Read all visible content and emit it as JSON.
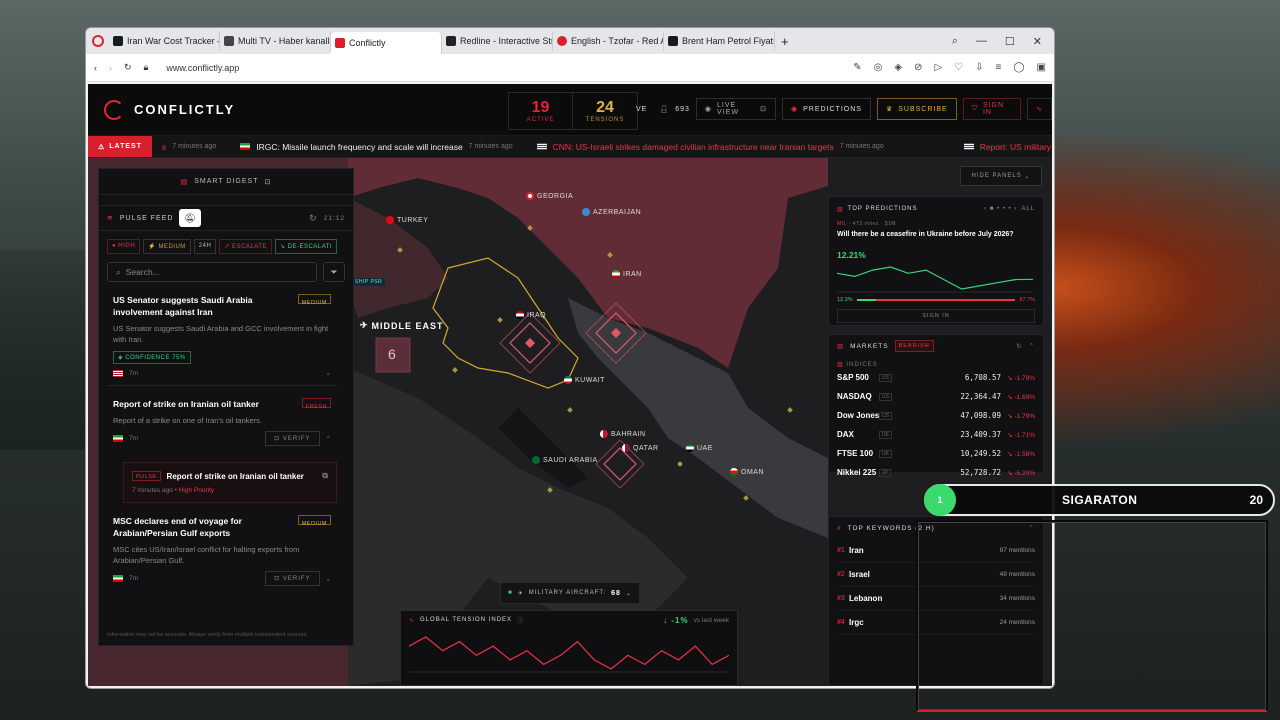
{
  "browser": {
    "tabs": [
      {
        "label": "Iran War Cost Tracker — L",
        "color": "#1a1a1a"
      },
      {
        "label": "Multi TV - Haber kanalları",
        "color": "#444444"
      },
      {
        "label": "Conflictly",
        "color": "#d91f2c"
      },
      {
        "label": "Redline - Interactive Strat",
        "color": "#222222"
      },
      {
        "label": "English - Tzofar - Red Aler",
        "color": "#d91f2c"
      },
      {
        "label": "Brent Ham Petrol Fiyatı —",
        "color": "#1a1a1a"
      }
    ],
    "url": "www.conflictly.app"
  },
  "app": {
    "name": "CONFLICTLY",
    "active": {
      "value": "19",
      "label": "ACTIVE"
    },
    "tensions": {
      "value": "24",
      "label": "TENSIONS"
    },
    "live_short": "VE",
    "viewers": "693",
    "live_view": "LIVE VIEW",
    "predictions": "PREDICTIONS",
    "subscribe": "SUBSCRIBE",
    "sign_in": "SIGN IN"
  },
  "ticker": {
    "label": "LATEST",
    "items": [
      {
        "flag": "none",
        "text": "s",
        "ago": "7 minutes ago",
        "color": "#e34"
      },
      {
        "flag": "ir",
        "text": "IRGC: Missile launch frequency and scale will increase",
        "ago": "7 minutes ago",
        "color": "#eeeeee"
      },
      {
        "flag": "us",
        "text": "CNN: US-Israeli strikes damaged civilian infrastructure near Iranian targets",
        "ago": "7 minutes ago",
        "color": "#e34"
      },
      {
        "flag": "us",
        "text": "Report: US military lost two more",
        "ago": "",
        "color": "#e34"
      }
    ]
  },
  "map": {
    "labels": {
      "georgia": "GEORGIA",
      "azerbaijan": "AZERBAIJAN",
      "turkey": "TURKEY",
      "iran": "IRAN",
      "iraq": "IRAQ",
      "kuwait": "KUWAIT",
      "bahrain": "BAHRAIN",
      "qatar": "QATAR",
      "uae": "UAE",
      "oman": "OMAN",
      "saudi": "SAUDI ARABIA",
      "middle_east": "MIDDLE EAST",
      "cluster": "6",
      "ship": "SHIP PSR"
    }
  },
  "left_panel": {
    "smart_digest": "SMART DIGEST",
    "pulse_feed": "PULSE FEED",
    "time": "21:12",
    "filters": [
      "HIGH",
      "MEDIUM",
      "24H",
      "ESCALATE",
      "DE-ESCALATI"
    ],
    "search_placeholder": "Search...",
    "cards": [
      {
        "title": "US Senator suggests Saudi Arabia involvement against Iran",
        "badge": "MEDIUM",
        "desc": "US Senator suggests Saudi Arabia and GCC involvement in fight with Iran.",
        "confidence": "CONFIDENCE 75%",
        "ago": "7m"
      },
      {
        "title": "Report of strike on Iranian oil tanker",
        "badge": "FRESH",
        "desc": "Report of a strike on one of Iran's oil tankers.",
        "ago": "7m",
        "verify": "VERIFY"
      },
      {
        "title": "MSC declares end of voyage for Arabian/Persian Gulf exports",
        "badge": "MEDIUM",
        "desc": "MSC cites US/Iran/Israel conflict for halting exports from Arabian/Persian Gulf.",
        "ago": "7m",
        "verify": "VERIFY"
      }
    ],
    "sub_card": {
      "badge": "PULSE",
      "title": "Report of strike on Iranian oil tanker",
      "ago": "7 minutes ago",
      "priority": "• High Priority"
    },
    "disclaimer": "Information may not be accurate. Always verify from multiple independent sources."
  },
  "right": {
    "hide_panels": "HIDE PANELS",
    "predictions": {
      "title": "TOP PREDICTIONS",
      "filter": "ALL",
      "source": "MIL",
      "votes": "473 votes",
      "vol": "$1M",
      "question": "Will there be a ceasefire in Ukraine before July 2026?",
      "pct": "12.21%",
      "low": "12.3%",
      "high": "87.7%",
      "signin": "SIGN IN",
      "series": [
        12.4,
        12.3,
        12.5,
        12.6,
        12.4,
        12.5,
        12.2,
        11.9,
        12.0,
        12.1,
        12.2,
        12.21
      ]
    },
    "markets": {
      "title": "MARKETS",
      "badge": "BEARISH",
      "indices_label": "INDICES",
      "rows": [
        {
          "name": "S&P 500",
          "tag": "US",
          "value": "6,708.57",
          "change": "-1.79%"
        },
        {
          "name": "NASDAQ",
          "tag": "US",
          "value": "22,364.47",
          "change": "-1.69%"
        },
        {
          "name": "Dow Jones",
          "tag": "US",
          "value": "47,098.09",
          "change": "-1.79%"
        },
        {
          "name": "DAX",
          "tag": "DE",
          "value": "23,409.37",
          "change": "-1.71%"
        },
        {
          "name": "FTSE 100",
          "tag": "UK",
          "value": "10,249.52",
          "change": "-1.58%"
        },
        {
          "name": "Nikkei 225",
          "tag": "JP",
          "value": "52,728.72",
          "change": "-5.20%"
        }
      ]
    },
    "keywords": {
      "title": "TOP KEYWORDS (2 H)",
      "rows": [
        {
          "rank": "#1",
          "word": "Iran",
          "mentions": "97 mentions"
        },
        {
          "rank": "#2",
          "word": "Israel",
          "mentions": "49 mentions"
        },
        {
          "rank": "#3",
          "word": "Lebanon",
          "mentions": "34 mentions"
        },
        {
          "rank": "#4",
          "word": "Irgc",
          "mentions": "24 mentions"
        }
      ]
    }
  },
  "military": {
    "label": "MILITARY AIRCRAFT:",
    "count": "68"
  },
  "tension": {
    "title": "GLOBAL TENSION INDEX",
    "change": "-1%",
    "vs": "vs last week",
    "series": [
      18,
      20,
      17,
      19,
      16,
      18,
      15,
      17,
      14,
      16,
      19,
      15,
      13,
      16,
      14,
      17,
      15,
      18,
      14,
      16
    ]
  },
  "overlay": {
    "rank": "1",
    "name": "SIGARATON",
    "count": "20"
  }
}
